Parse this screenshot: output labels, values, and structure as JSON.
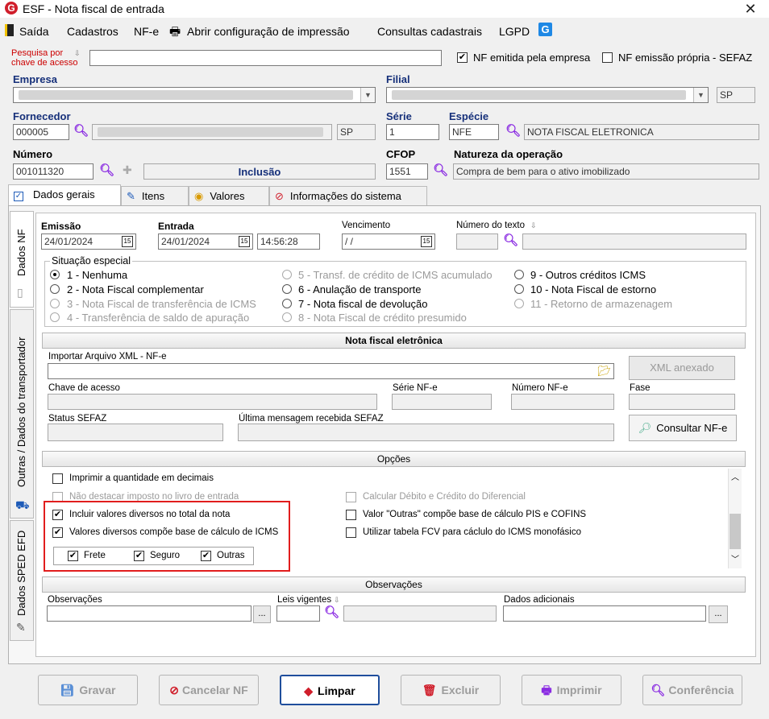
{
  "window": {
    "title": "ESF - Nota fiscal de entrada",
    "app_icon_letter": "G"
  },
  "menu": [
    "Saída",
    "Cadastros",
    "NF-e",
    "Abrir configuração de impressão",
    "Consultas cadastrais",
    "LGPD"
  ],
  "search": {
    "label": "Pesquisa por chave de acesso",
    "value": ""
  },
  "top_checks": {
    "nf_empresa": "NF emitida pela empresa",
    "nf_propria": "NF emissão própria - SEFAZ"
  },
  "empresa": {
    "label": "Empresa",
    "value": ""
  },
  "filial": {
    "label": "Filial",
    "value": "",
    "uf": "SP"
  },
  "fornecedor": {
    "label": "Fornecedor",
    "code": "000005",
    "uf": "SP"
  },
  "serie": {
    "label": "Série",
    "value": "1"
  },
  "especie": {
    "label": "Espécie",
    "code": "NFE",
    "description": "NOTA FISCAL ELETRONICA"
  },
  "numero": {
    "label": "Número",
    "value": "001011320",
    "mode": "Inclusão"
  },
  "cfop": {
    "label": "CFOP",
    "value": "1551"
  },
  "natureza": {
    "label": "Natureza da operação",
    "value": "Compra de bem para o ativo imobilizado"
  },
  "tabs": [
    "Dados gerais",
    "Itens",
    "Valores",
    "Informações do sistema"
  ],
  "vtabs": [
    "Dados NF",
    "Outras / Dados do transportador",
    "Dados SPED EFD"
  ],
  "dados_nf": {
    "emissao": {
      "label": "Emissão",
      "value": "24/01/2024"
    },
    "entrada": {
      "label": "Entrada",
      "date": "24/01/2024",
      "time": "14:56:28"
    },
    "vencimento": {
      "label": "Vencimento",
      "value": " / /"
    },
    "numero_texto": {
      "label": "Número do texto"
    },
    "calendar_icon_text": "15"
  },
  "situacao": {
    "title": "Situação especial",
    "options": [
      "1 - Nenhuma",
      "2 - Nota Fiscal complementar",
      "3 - Nota Fiscal de transferência de ICMS",
      "4 - Transferência de saldo de apuração",
      "5 - Transf. de crédito de ICMS acumulado",
      "6 - Anulação de transporte",
      "7 - Nota fiscal de devolução",
      "8 - Nota Fiscal de crédito presumido",
      "9 - Outros créditos ICMS",
      "10 - Nota Fiscal de estorno",
      "11 - Retorno de armazenagem"
    ]
  },
  "nfe": {
    "header": "Nota fiscal eletrônica",
    "import_label": "Importar Arquivo XML - NF-e",
    "xml_btn": "XML anexado",
    "chave_label": "Chave de acesso",
    "serie_label": "Série NF-e",
    "numero_label": "Número NF-e",
    "fase_label": "Fase",
    "status_label": "Status SEFAZ",
    "msg_label": "Última mensagem recebida SEFAZ",
    "consultar_btn": "Consultar NF-e"
  },
  "opcoes": {
    "header": "Opções",
    "items": [
      "Imprimir a quantidade em decimais",
      "Não destacar imposto no livro de entrada",
      "Incluir valores diversos no total da nota",
      "Valores diversos compõe base de cálculo de ICMS",
      "Calcular Débito e Crédito do Diferencial",
      "Valor \"Outras\" compõe base de cálculo PIS e COFINS",
      "Utilizar tabela FCV para cáclulo do ICMS monofásico"
    ],
    "sub": [
      "Frete",
      "Seguro",
      "Outras"
    ]
  },
  "observacoes": {
    "header": "Observações",
    "obs_label": "Observações",
    "leis_label": "Leis vigentes",
    "dados_label": "Dados adicionais",
    "ellipsis": "..."
  },
  "buttons": [
    "Gravar",
    "Cancelar NF",
    "Limpar",
    "Excluir",
    "Imprimir",
    "Conferência"
  ],
  "colors": {
    "accent": "#16307a",
    "highlight": "#e11d1d"
  }
}
